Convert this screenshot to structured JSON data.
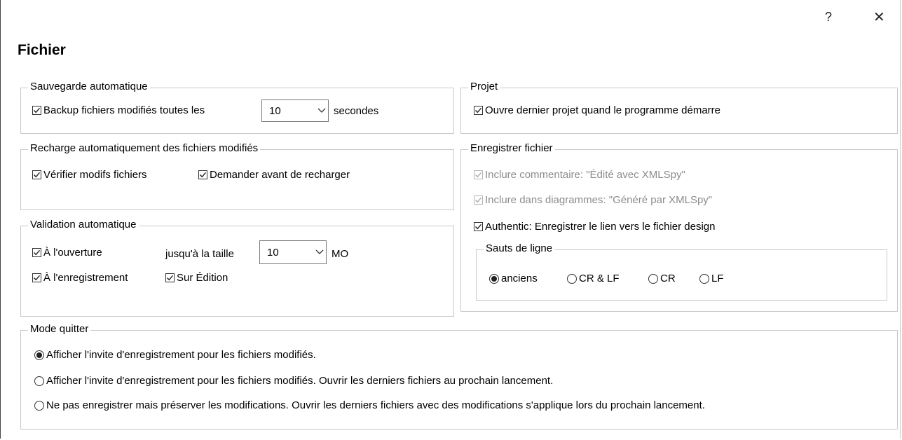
{
  "window": {
    "help": "?",
    "close": "✕"
  },
  "page_title": "Fichier",
  "autosave": {
    "legend": "Sauvegarde automatique",
    "backup_label": "Backup fichiers modifiés toutes les",
    "backup_checked": true,
    "interval_value": "10",
    "unit": "secondes"
  },
  "project": {
    "legend": "Projet",
    "open_last_label": "Ouvre dernier projet quand le programme démarre",
    "open_last_checked": true
  },
  "reload": {
    "legend": "Recharge automatiquement des fichiers modifiés",
    "check_label": "Vérifier modifs fichiers",
    "ask_label": "Demander avant de recharger"
  },
  "save_file": {
    "legend": "Enregistrer fichier",
    "comment_label": "Inclure commentaire: \"Édité avec XMLSpy\"",
    "diagram_label": "Inclure dans diagrammes: \"Généré par XMLSpy\"",
    "authentic_label": "Authentic: Enregistrer le lien vers le fichier design",
    "line_breaks": {
      "legend": "Sauts de ligne",
      "options": [
        "anciens",
        "CR & LF",
        "CR",
        "LF"
      ],
      "selected": "anciens"
    }
  },
  "validation": {
    "legend": "Validation automatique",
    "on_open_label": "À l'ouverture",
    "size_label": "jusqu'à la taille",
    "size_value": "10",
    "size_unit": "MO",
    "on_save_label": "À l'enregistrement",
    "on_edit_label": "Sur Édition"
  },
  "quit_mode": {
    "legend": "Mode quitter",
    "options": [
      "Afficher l'invite d'enregistrement pour les fichiers modifiés.",
      "Afficher l'invite d'enregistrement pour les fichiers modifiés. Ouvrir les derniers fichiers au prochain lancement.",
      "Ne pas enregistrer mais préserver les modifications. Ouvrir les derniers fichiers avec des modifications s'applique lors du prochain lancement."
    ],
    "selected_index": 0
  }
}
